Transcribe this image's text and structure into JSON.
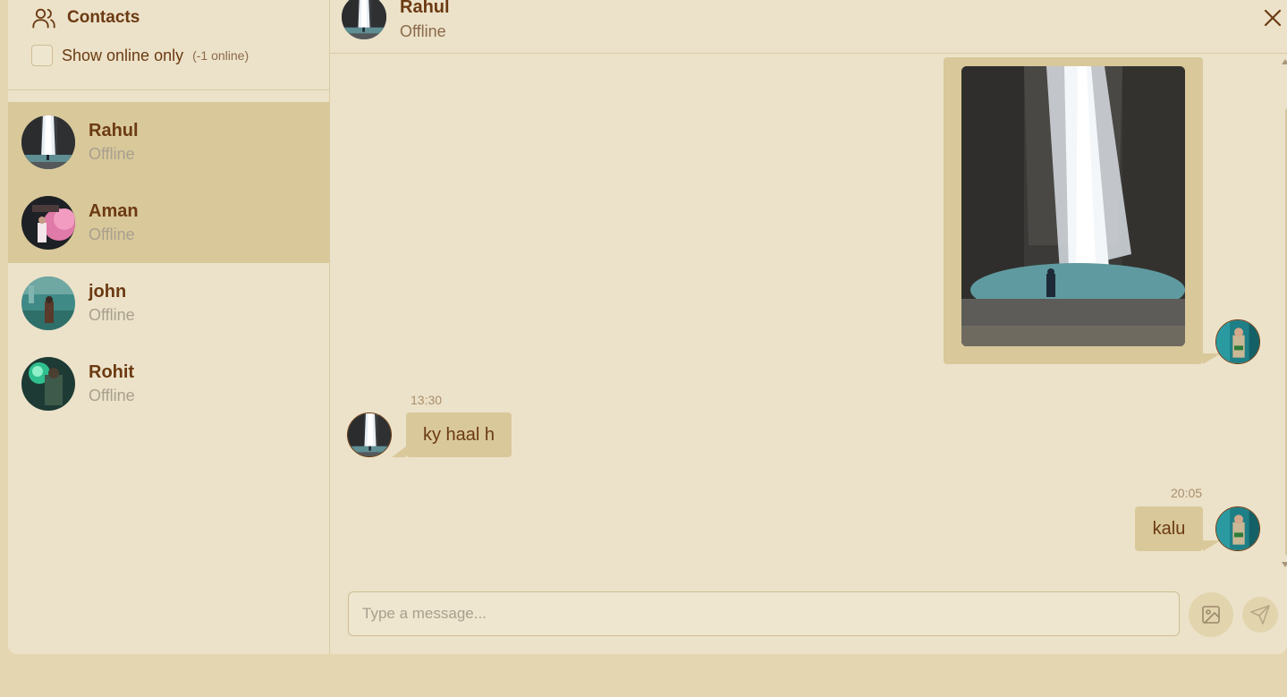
{
  "sidebar": {
    "title": "Contacts",
    "filter_label": "Show online only",
    "filter_count": "(-1 online)",
    "contacts": [
      {
        "name": "Rahul",
        "status": "Offline"
      },
      {
        "name": "Aman",
        "status": "Offline"
      },
      {
        "name": "john",
        "status": "Offline"
      },
      {
        "name": "Rohit",
        "status": "Offline"
      }
    ]
  },
  "chat": {
    "name": "Rahul",
    "status": "Offline",
    "messages": [
      {
        "type": "image",
        "from": "me"
      },
      {
        "type": "text",
        "from": "them",
        "time": "13:30",
        "text": "ky haal h"
      },
      {
        "type": "text",
        "from": "me",
        "time": "20:05",
        "text": "kalu"
      }
    ],
    "composer_placeholder": "Type a message..."
  },
  "colors": {
    "accent": "#6b3a12",
    "bubble": "#d9c89a",
    "background": "#ece2c9"
  }
}
